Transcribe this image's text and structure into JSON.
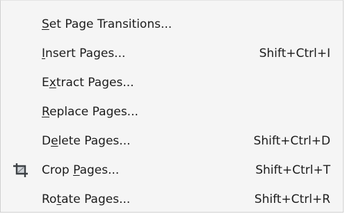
{
  "menu": {
    "items": [
      {
        "label": "Set Page Transitions...",
        "mnemonic_index": 0,
        "shortcut": ""
      },
      {
        "label": "Insert Pages...",
        "mnemonic_index": 0,
        "shortcut": "Shift+Ctrl+I"
      },
      {
        "label": "Extract Pages...",
        "mnemonic_index": 1,
        "shortcut": ""
      },
      {
        "label": "Replace Pages...",
        "mnemonic_index": 0,
        "shortcut": ""
      },
      {
        "label": "Delete Pages...",
        "mnemonic_index": 1,
        "shortcut": "Shift+Ctrl+D"
      },
      {
        "label": "Crop Pages...",
        "mnemonic_index": 5,
        "shortcut": "Shift+Ctrl+T",
        "icon": "crop-icon"
      },
      {
        "label": "Rotate Pages...",
        "mnemonic_index": 2,
        "shortcut": "Shift+Ctrl+R"
      }
    ]
  }
}
